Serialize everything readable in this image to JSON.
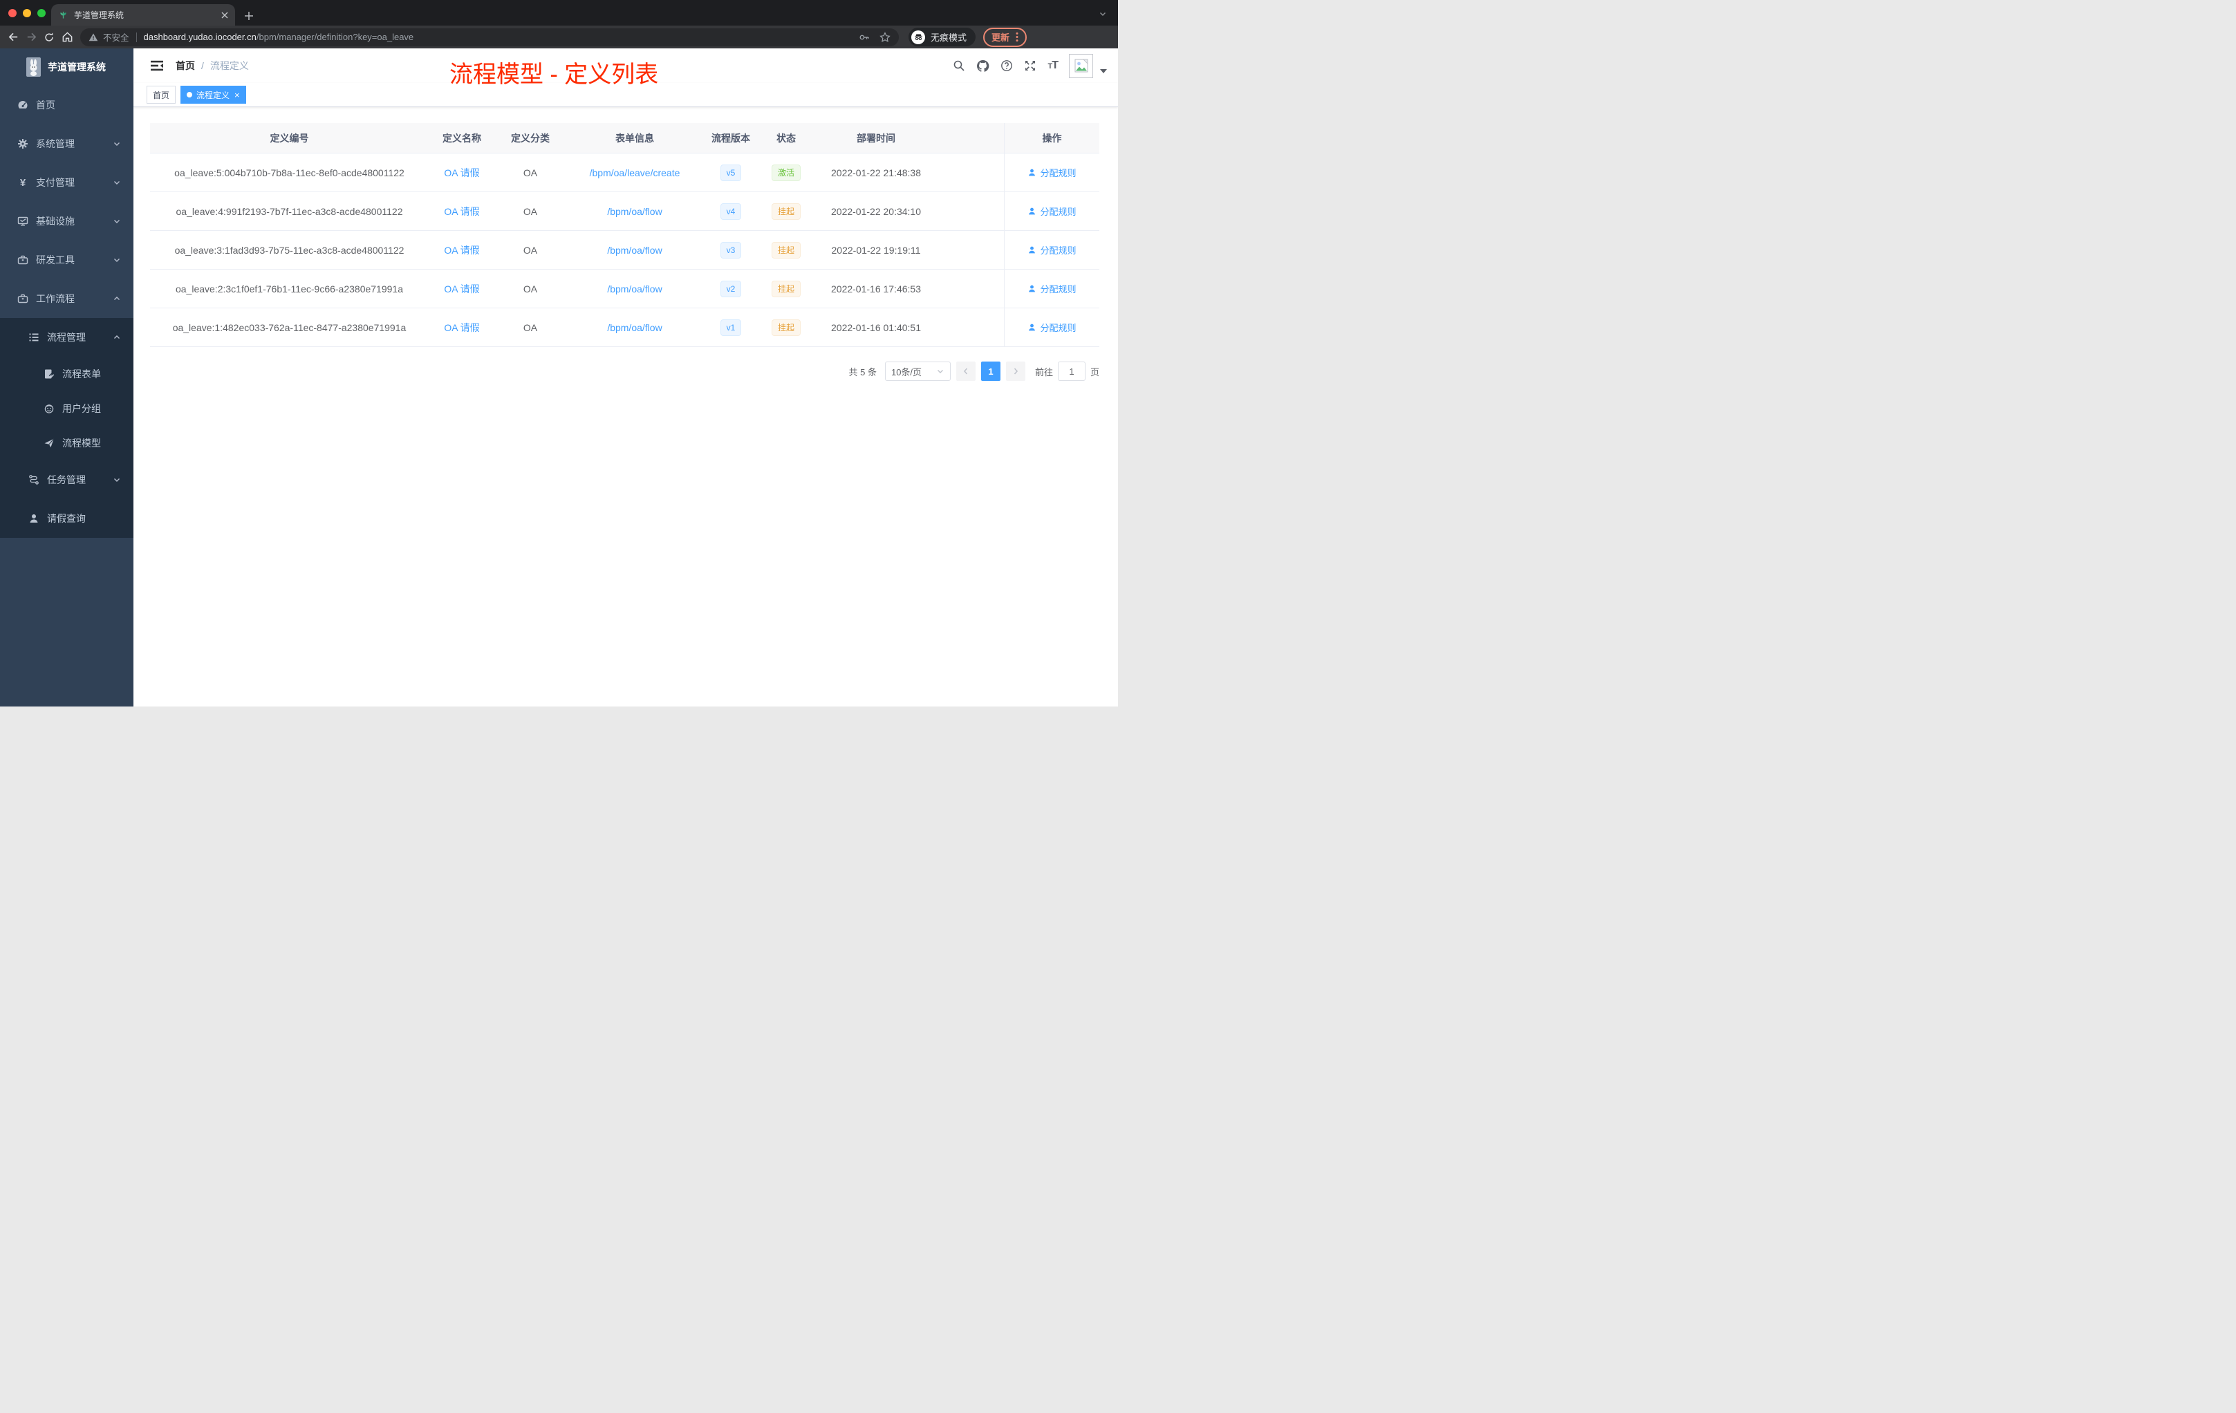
{
  "browser": {
    "tab_title": "芋道管理系统",
    "security_label": "不安全",
    "url_host": "dashboard.yudao.iocoder.cn",
    "url_path": "/bpm/manager/definition?key=oa_leave",
    "incognito_label": "无痕模式",
    "update_label": "更新"
  },
  "sidebar": {
    "logo_title": "芋道管理系统",
    "menu": [
      {
        "name": "home",
        "label": "首页",
        "icon": "dashboard-icon",
        "level": 1,
        "arrow": null
      },
      {
        "name": "system",
        "label": "系统管理",
        "icon": "gear-icon",
        "level": 1,
        "arrow": "down"
      },
      {
        "name": "payment",
        "label": "支付管理",
        "icon": "yen-icon",
        "level": 1,
        "arrow": "down"
      },
      {
        "name": "infrastructure",
        "label": "基础设施",
        "icon": "monitor-icon",
        "level": 1,
        "arrow": "down"
      },
      {
        "name": "dev-tools",
        "label": "研发工具",
        "icon": "toolbox-icon",
        "level": 1,
        "arrow": "down"
      },
      {
        "name": "workflow",
        "label": "工作流程",
        "icon": "briefcase-icon",
        "level": 1,
        "arrow": "up"
      },
      {
        "name": "process-management",
        "label": "流程管理",
        "icon": "list-icon",
        "level": 2,
        "arrow": "up"
      },
      {
        "name": "process-form",
        "label": "流程表单",
        "icon": "form-icon",
        "level": 3,
        "arrow": null
      },
      {
        "name": "user-group",
        "label": "用户分组",
        "icon": "robot-icon",
        "level": 3,
        "arrow": null
      },
      {
        "name": "process-model",
        "label": "流程模型",
        "icon": "paper-plane-icon",
        "level": 3,
        "arrow": null
      },
      {
        "name": "task-management",
        "label": "任务管理",
        "icon": "flow-icon",
        "level": 2,
        "arrow": "down"
      },
      {
        "name": "leave-query",
        "label": "请假查询",
        "icon": "user-icon",
        "level": 2,
        "arrow": null
      }
    ]
  },
  "navbar": {
    "breadcrumb": [
      "首页",
      "流程定义"
    ],
    "overlay_title": "流程模型 - 定义列表"
  },
  "tags": [
    {
      "label": "首页",
      "active": false
    },
    {
      "label": "流程定义",
      "active": true
    }
  ],
  "table": {
    "columns": [
      "定义编号",
      "定义名称",
      "定义分类",
      "表单信息",
      "流程版本",
      "状态",
      "部署时间",
      "操作"
    ],
    "rows": [
      {
        "id": "oa_leave:5:004b710b-7b8a-11ec-8ef0-acde48001122",
        "name": "OA 请假",
        "category": "OA",
        "form": "/bpm/oa/leave/create",
        "version": "v5",
        "status": "激活",
        "status_type": "success",
        "deployed": "2022-01-22 21:48:38",
        "action": "分配规则"
      },
      {
        "id": "oa_leave:4:991f2193-7b7f-11ec-a3c8-acde48001122",
        "name": "OA 请假",
        "category": "OA",
        "form": "/bpm/oa/flow",
        "version": "v4",
        "status": "挂起",
        "status_type": "warning",
        "deployed": "2022-01-22 20:34:10",
        "action": "分配规则"
      },
      {
        "id": "oa_leave:3:1fad3d93-7b75-11ec-a3c8-acde48001122",
        "name": "OA 请假",
        "category": "OA",
        "form": "/bpm/oa/flow",
        "version": "v3",
        "status": "挂起",
        "status_type": "warning",
        "deployed": "2022-01-22 19:19:11",
        "action": "分配规则"
      },
      {
        "id": "oa_leave:2:3c1f0ef1-76b1-11ec-9c66-a2380e71991a",
        "name": "OA 请假",
        "category": "OA",
        "form": "/bpm/oa/flow",
        "version": "v2",
        "status": "挂起",
        "status_type": "warning",
        "deployed": "2022-01-16 17:46:53",
        "action": "分配规则"
      },
      {
        "id": "oa_leave:1:482ec033-762a-11ec-8477-a2380e71991a",
        "name": "OA 请假",
        "category": "OA",
        "form": "/bpm/oa/flow",
        "version": "v1",
        "status": "挂起",
        "status_type": "warning",
        "deployed": "2022-01-16 01:40:51",
        "action": "分配规则"
      }
    ]
  },
  "pagination": {
    "total": "共 5 条",
    "page_size": "10条/页",
    "page": "1",
    "goto_label": "前往",
    "goto_value": "1",
    "goto_suffix": "页"
  },
  "colors": {
    "accent": "#409eff",
    "annotation_red": "#fd2b01",
    "success": "#67c23a",
    "warning": "#e6a23c",
    "sidebar_bg": "#304156",
    "submenu_bg": "#1f2d3d"
  }
}
